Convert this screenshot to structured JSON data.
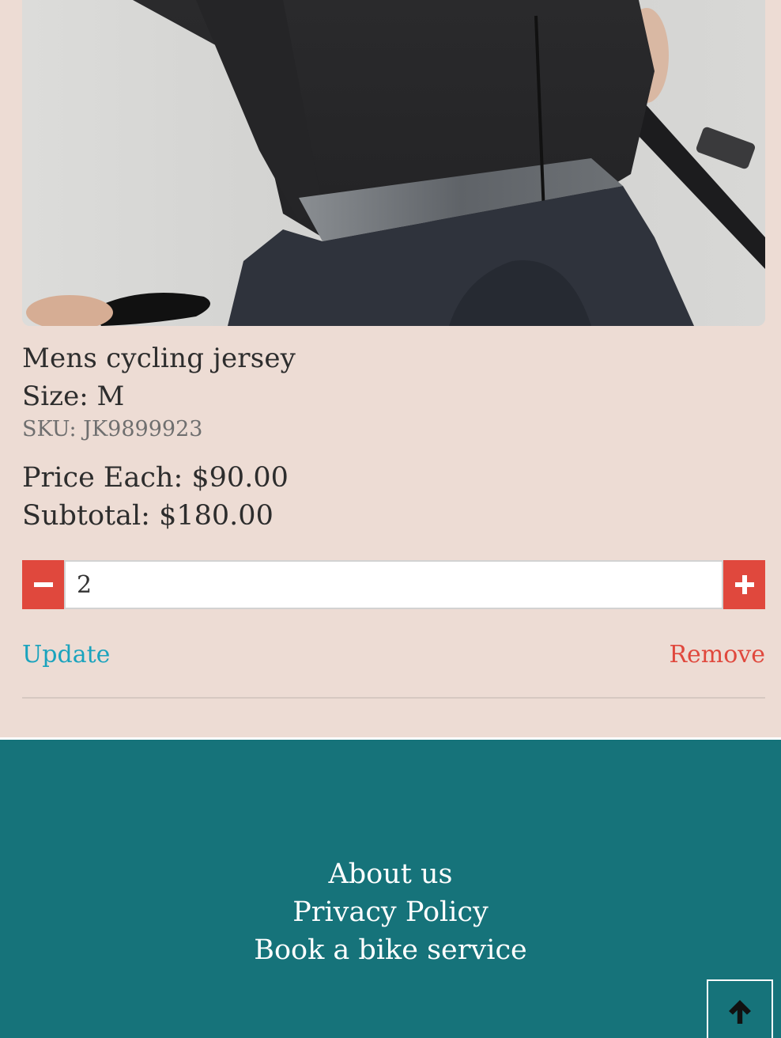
{
  "product": {
    "image_alt": "Cyclist in black jersey holding bike",
    "name": "Mens cycling jersey",
    "size_label": "Size: M",
    "sku_label": "SKU: JK9899923",
    "price_each_label": "Price Each: $90.00",
    "subtotal_label": "Subtotal: $180.00"
  },
  "quantity": {
    "value": "2",
    "decrement_icon": "minus-icon",
    "increment_icon": "plus-icon"
  },
  "actions": {
    "update_label": "Update",
    "remove_label": "Remove"
  },
  "footer": {
    "links": [
      "About us",
      "Privacy Policy",
      "Book a bike service"
    ],
    "back_to_top_icon": "arrow-up-icon"
  },
  "colors": {
    "page_bg": "#eddcd4",
    "accent_red": "#e0483d",
    "link_teal": "#1aa3bd",
    "footer_bg": "#16737a"
  }
}
